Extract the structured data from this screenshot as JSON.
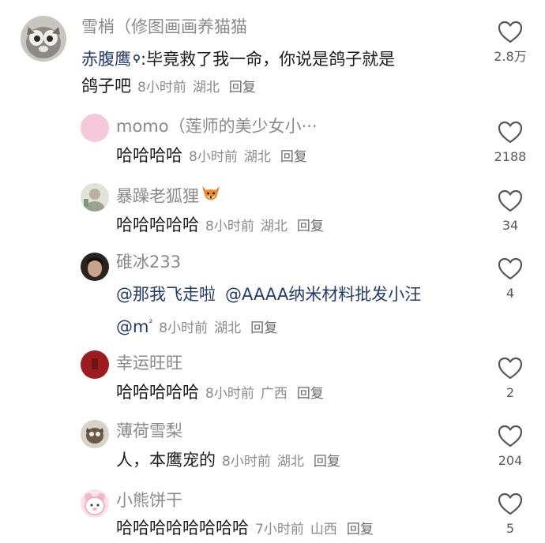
{
  "comments": [
    {
      "username": "雪梢（修图画画养猫猫",
      "mention": "赤腹鹰",
      "text": ":毕竟救了我一命，你说是鸽子就是",
      "text_line2": "鸽子吧",
      "time": "8小时前",
      "location": "湖北",
      "reply": "回复",
      "likes": "2.8万"
    },
    {
      "username": "momo（莲师的美少女小···",
      "text": "哈哈哈哈",
      "time": "8小时前",
      "location": "湖北",
      "reply": "回复",
      "likes": "2188"
    },
    {
      "username": "暴躁老狐狸",
      "text": "哈哈哈哈哈",
      "time": "8小时前",
      "location": "湖北",
      "reply": "回复",
      "likes": "34"
    },
    {
      "username": "碓冰233",
      "mention1": "@那我飞走啦",
      "mention2": "@AAAA纳米材料批发小汪",
      "mention3": "@m",
      "mention3_sup": "²",
      "time": "8小时前",
      "location": "湖北",
      "reply": "回复",
      "likes": "4"
    },
    {
      "username": "幸运旺旺",
      "text": "哈哈哈哈哈",
      "time": "8小时前",
      "location": "广西",
      "reply": "回复",
      "likes": "2"
    },
    {
      "username": "薄荷雪梨",
      "text": "人，本鹰宠的",
      "time": "8小时前",
      "location": "湖北",
      "reply": "回复",
      "likes": "204"
    },
    {
      "username": "小熊饼干",
      "text": "哈哈哈哈哈哈哈哈",
      "time": "7小时前",
      "location": "山西",
      "reply": "回复",
      "likes": "5"
    }
  ],
  "colors": {
    "username": "#8a8a8a",
    "text": "#1c1c1c",
    "mention": "#243a6e",
    "heart_stroke": "#555555"
  },
  "icons": [
    "heart-outline-icon",
    "location-pin-icon",
    "fox-emoji-icon"
  ]
}
